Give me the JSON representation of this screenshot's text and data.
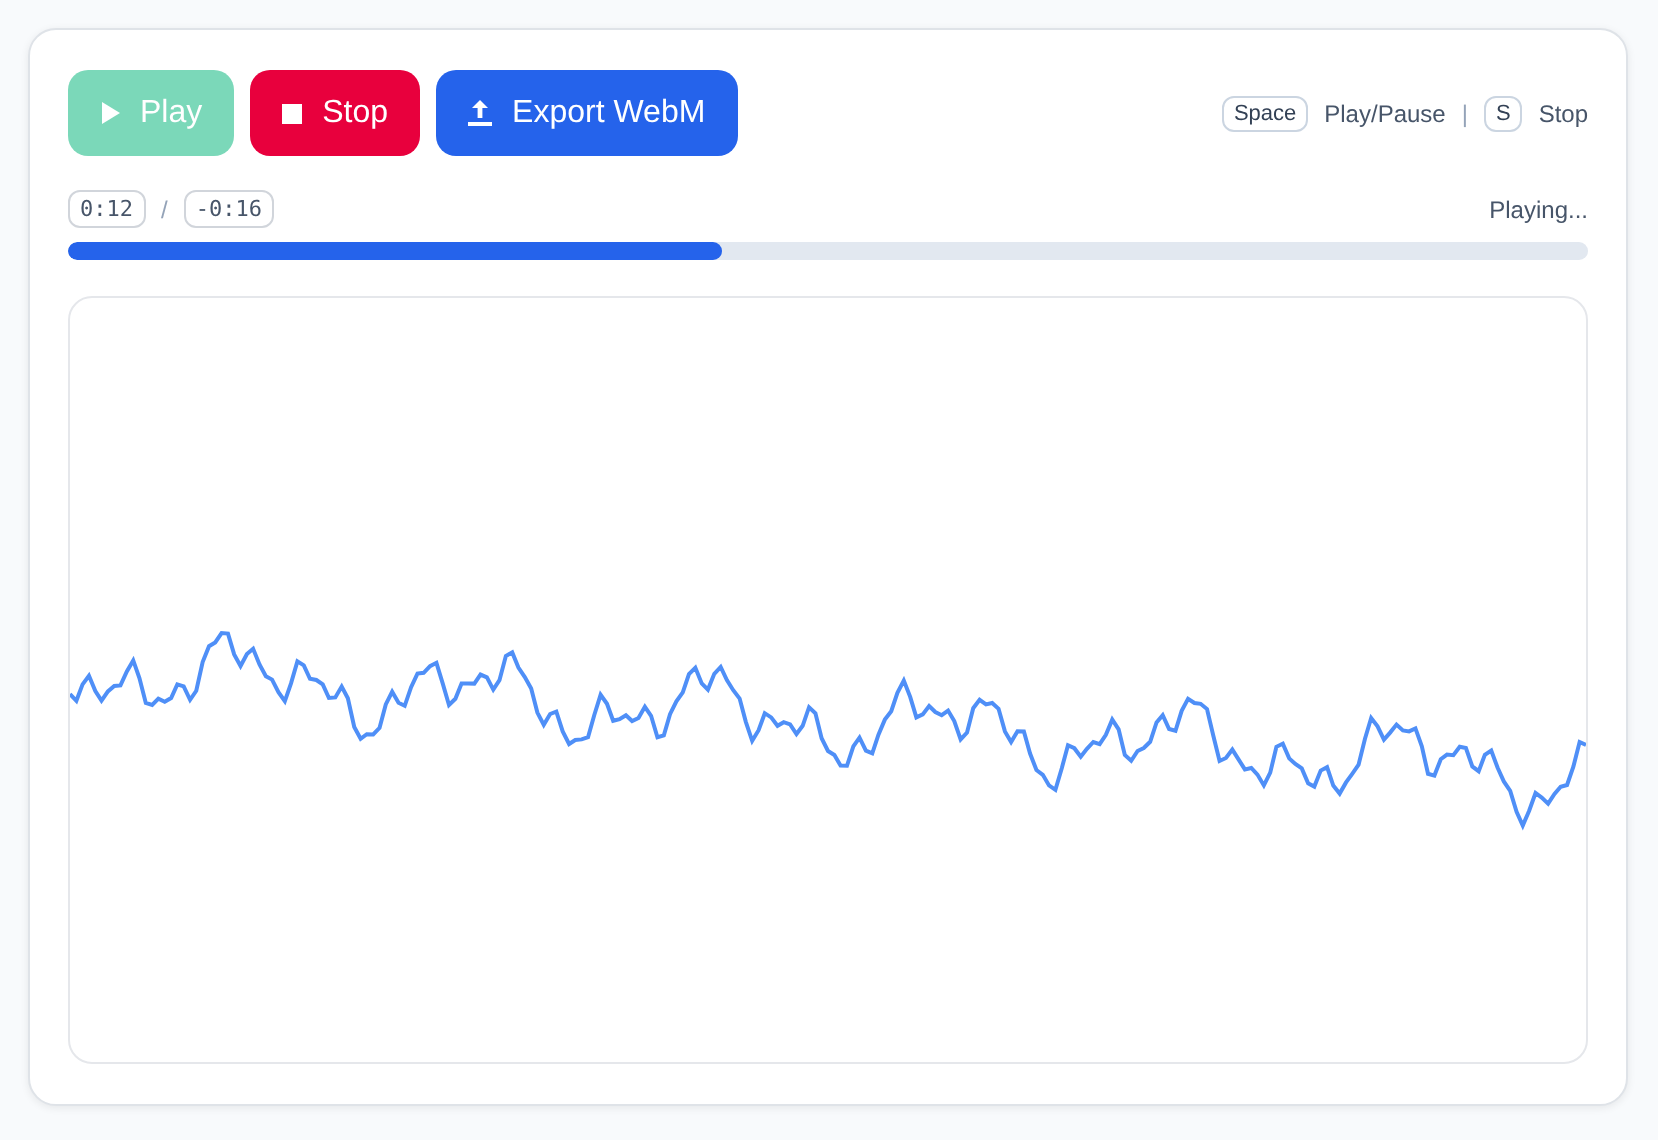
{
  "controls": [
    {
      "kind": "play",
      "label": "Play",
      "disabled": true
    },
    {
      "kind": "stop",
      "label": "Stop",
      "disabled": false
    },
    {
      "kind": "export",
      "label": "Export WebM",
      "disabled": false
    }
  ],
  "shortcuts": [
    {
      "key": "Space",
      "action": "Play/Pause"
    },
    {
      "key": "S",
      "action": "Stop"
    }
  ],
  "separator": "|",
  "time": {
    "elapsed": "0:12",
    "divider": "/",
    "remaining": "-0:16"
  },
  "status": "Playing...",
  "progress": {
    "level": 0.43
  }
}
